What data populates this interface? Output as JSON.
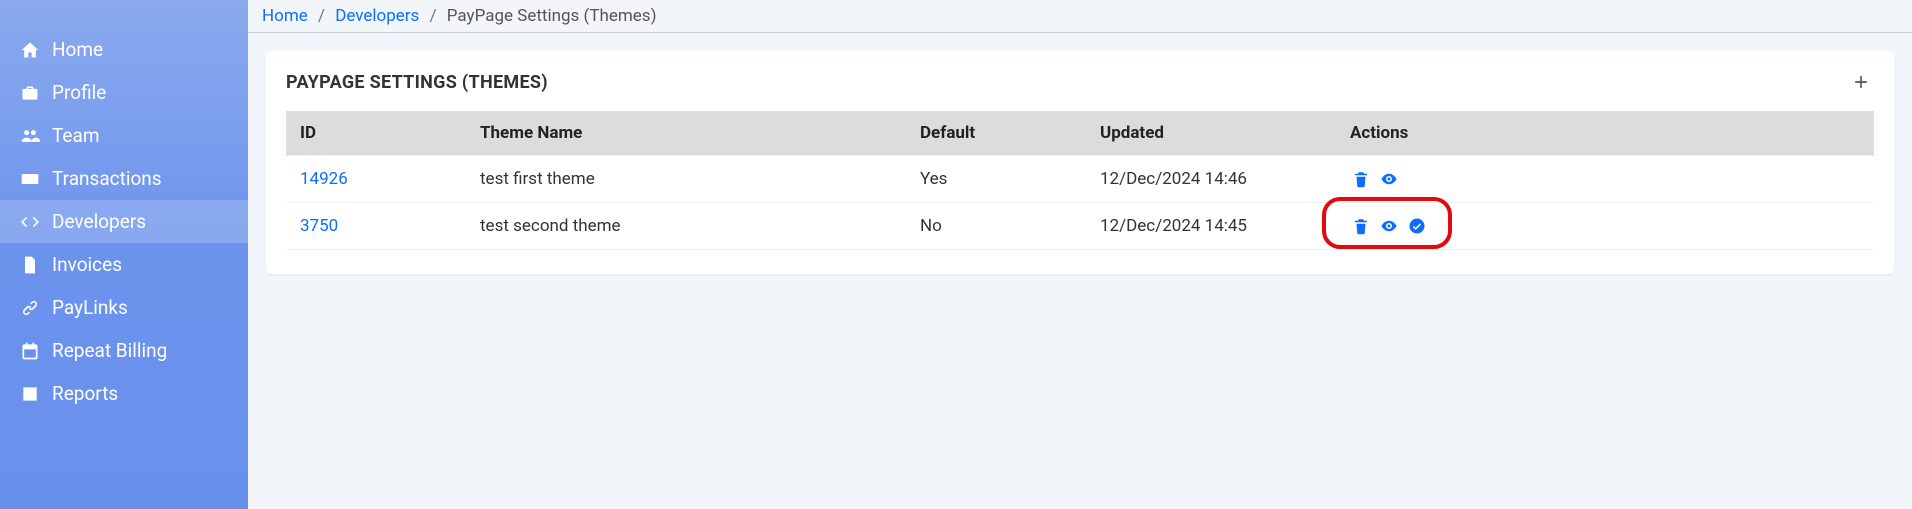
{
  "sidebar": {
    "items": [
      {
        "label": "Home",
        "icon": "home-icon",
        "active": false
      },
      {
        "label": "Profile",
        "icon": "briefcase-icon",
        "active": false
      },
      {
        "label": "Team",
        "icon": "users-icon",
        "active": false
      },
      {
        "label": "Transactions",
        "icon": "card-icon",
        "active": false
      },
      {
        "label": "Developers",
        "icon": "code-icon",
        "active": true
      },
      {
        "label": "Invoices",
        "icon": "file-icon",
        "active": false
      },
      {
        "label": "PayLinks",
        "icon": "link-icon",
        "active": false
      },
      {
        "label": "Repeat Billing",
        "icon": "calendar-icon",
        "active": false
      },
      {
        "label": "Reports",
        "icon": "report-icon",
        "active": false
      }
    ]
  },
  "breadcrumb": {
    "parts": [
      {
        "label": "Home",
        "link": true
      },
      {
        "label": "Developers",
        "link": true
      },
      {
        "label": "PayPage Settings (Themes)",
        "link": false
      }
    ],
    "sep": "/"
  },
  "card": {
    "title": "PAYPAGE SETTINGS (THEMES)"
  },
  "table": {
    "headers": {
      "id": "ID",
      "name": "Theme Name",
      "default": "Default",
      "updated": "Updated",
      "actions": "Actions"
    },
    "rows": [
      {
        "id": "14926",
        "name": "test first theme",
        "default": "Yes",
        "updated": "12/Dec/2024 14:46",
        "show_check": false,
        "highlight": false
      },
      {
        "id": "3750",
        "name": "test second theme",
        "default": "No",
        "updated": "12/Dec/2024 14:45",
        "show_check": true,
        "highlight": true
      }
    ]
  },
  "colors": {
    "link": "#0d6efd",
    "highlight": "#e10b0b"
  }
}
